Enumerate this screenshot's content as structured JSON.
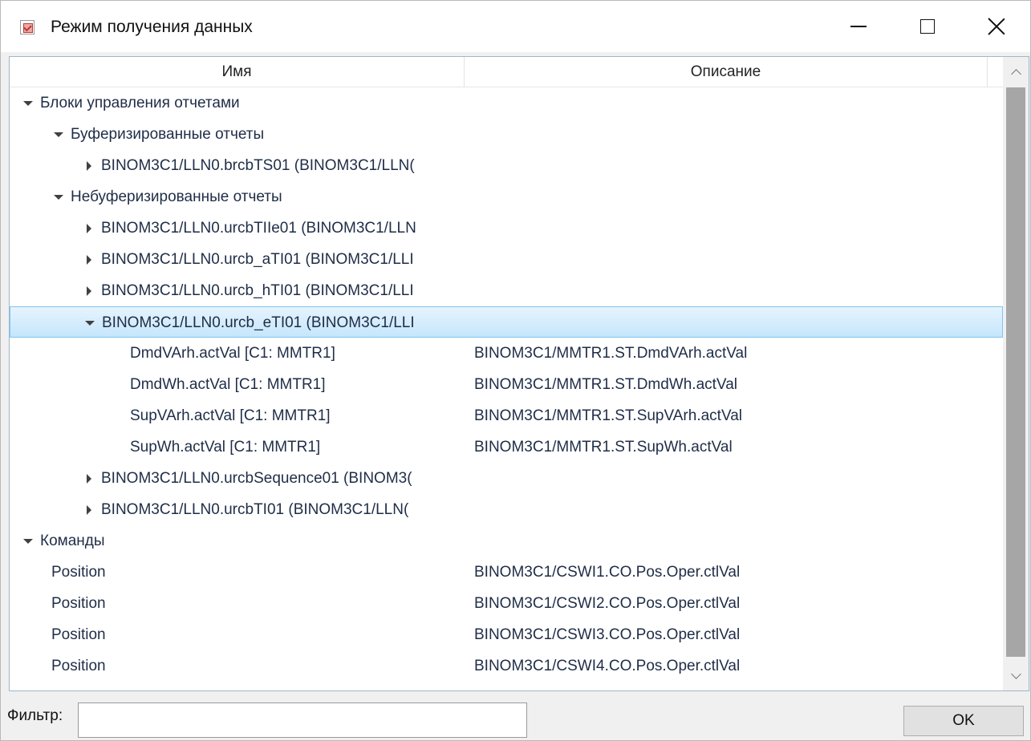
{
  "window": {
    "title": "Режим получения данных"
  },
  "columns": {
    "name": "Имя",
    "description": "Описание"
  },
  "tree": {
    "rows": [
      {
        "level": 0,
        "toggle": "expanded",
        "name": "Блоки управления отчетами",
        "description": ""
      },
      {
        "level": 1,
        "toggle": "expanded",
        "name": "Буферизированные отчеты",
        "description": ""
      },
      {
        "level": 2,
        "toggle": "collapsed",
        "name": "BINOM3C1/LLN0.brcbTS01 (BINOM3C1/LLN(",
        "description": ""
      },
      {
        "level": 1,
        "toggle": "expanded",
        "name": "Небуферизированные отчеты",
        "description": ""
      },
      {
        "level": 2,
        "toggle": "collapsed",
        "name": "BINOM3C1/LLN0.urcbTIIe01 (BINOM3C1/LLN",
        "description": ""
      },
      {
        "level": 2,
        "toggle": "collapsed",
        "name": "BINOM3C1/LLN0.urcb_aTI01 (BINOM3C1/LLI",
        "description": ""
      },
      {
        "level": 2,
        "toggle": "collapsed",
        "name": "BINOM3C1/LLN0.urcb_hTI01 (BINOM3C1/LLI",
        "description": ""
      },
      {
        "level": 2,
        "toggle": "expanded",
        "name": "BINOM3C1/LLN0.urcb_eTI01 (BINOM3C1/LLI",
        "description": "",
        "selected": true
      },
      {
        "level": 3,
        "toggle": "none",
        "name": "DmdVArh.actVal [C1: MMTR1]",
        "description": "BINOM3C1/MMTR1.ST.DmdVArh.actVal"
      },
      {
        "level": 3,
        "toggle": "none",
        "name": "DmdWh.actVal [C1: MMTR1]",
        "description": "BINOM3C1/MMTR1.ST.DmdWh.actVal"
      },
      {
        "level": 3,
        "toggle": "none",
        "name": "SupVArh.actVal [C1: MMTR1]",
        "description": "BINOM3C1/MMTR1.ST.SupVArh.actVal"
      },
      {
        "level": 3,
        "toggle": "none",
        "name": "SupWh.actVal [C1: MMTR1]",
        "description": "BINOM3C1/MMTR1.ST.SupWh.actVal"
      },
      {
        "level": 2,
        "toggle": "collapsed",
        "name": "BINOM3C1/LLN0.urcbSequence01 (BINOM3(",
        "description": ""
      },
      {
        "level": 2,
        "toggle": "collapsed",
        "name": "BINOM3C1/LLN0.urcbTI01 (BINOM3C1/LLN(",
        "description": ""
      },
      {
        "level": 0,
        "toggle": "expanded",
        "name": "Команды",
        "description": ""
      },
      {
        "level": 1,
        "toggle": "none",
        "name": "Position",
        "description": "BINOM3C1/CSWI1.CO.Pos.Oper.ctlVal"
      },
      {
        "level": 1,
        "toggle": "none",
        "name": "Position",
        "description": "BINOM3C1/CSWI2.CO.Pos.Oper.ctlVal"
      },
      {
        "level": 1,
        "toggle": "none",
        "name": "Position",
        "description": "BINOM3C1/CSWI3.CO.Pos.Oper.ctlVal"
      },
      {
        "level": 1,
        "toggle": "none",
        "name": "Position",
        "description": "BINOM3C1/CSWI4.CO.Pos.Oper.ctlVal"
      }
    ]
  },
  "footer": {
    "filter_label": "Фильтр:",
    "filter_value": "",
    "ok_label": "OK"
  },
  "icons": {
    "app": "report-settings-icon",
    "minimize": "minimize-icon",
    "maximize": "maximize-icon",
    "close": "close-icon",
    "expanded": "triangle-down-icon",
    "collapsed": "triangle-right-icon"
  },
  "colors": {
    "selection_border": "#7fc6f2",
    "selection_fill": "#c5e6fc",
    "text": "#1f2d47",
    "scroll_thumb": "#a6a6a6"
  }
}
